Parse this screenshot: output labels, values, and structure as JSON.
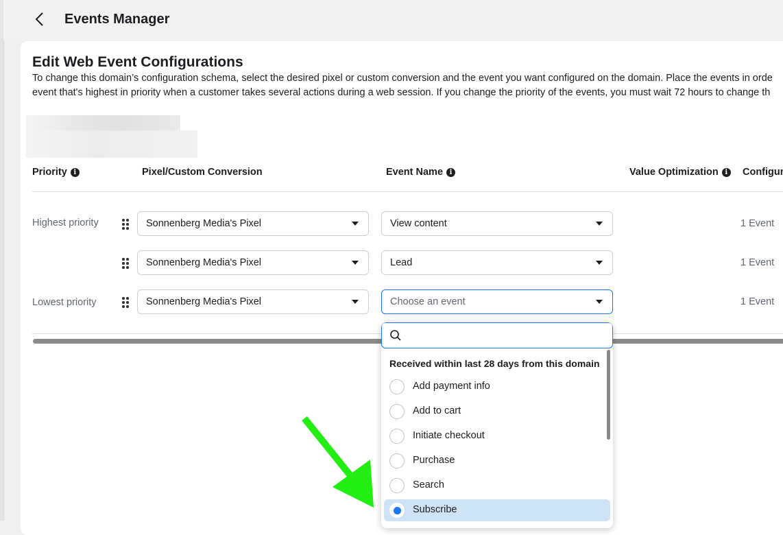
{
  "header": {
    "title": "Events Manager",
    "back_icon": "chevron-left-icon"
  },
  "card": {
    "title": "Edit Web Event Configurations",
    "description_line1": "To change this domain’s configuration schema, select the desired pixel or custom conversion and the event you want configured on the domain. Place the events in orde",
    "description_line2": "event that's highest in priority when a customer takes several actions during a web session. If you change the priority of the events, you must wait 72 hours to change th"
  },
  "table": {
    "headers": {
      "priority": "Priority",
      "pixel": "Pixel/Custom Conversion",
      "event": "Event Name",
      "value_opt": "Value Optimization",
      "configured": "Configur"
    },
    "rows": [
      {
        "priority_label": "Highest priority",
        "pixel": "Sonnenberg Media's Pixel",
        "event": "View content",
        "count": "1 Event"
      },
      {
        "priority_label": "",
        "pixel": "Sonnenberg Media's Pixel",
        "event": "Lead",
        "count": "1 Event"
      },
      {
        "priority_label": "Lowest priority",
        "pixel": "Sonnenberg Media's Pixel",
        "event": "Choose an event",
        "count": "1 Event"
      }
    ]
  },
  "dropdown": {
    "search_placeholder": "",
    "section_title": "Received within last 28 days from this domain",
    "options": [
      {
        "label": "Add payment info",
        "selected": false
      },
      {
        "label": "Add to cart",
        "selected": false
      },
      {
        "label": "Initiate checkout",
        "selected": false
      },
      {
        "label": "Purchase",
        "selected": false
      },
      {
        "label": "Search",
        "selected": false
      },
      {
        "label": "Subscribe",
        "selected": true
      }
    ]
  },
  "colors": {
    "accent": "#1877f2",
    "selected_bg": "#cfe3f7",
    "annotation_arrow": "#22ee11"
  }
}
